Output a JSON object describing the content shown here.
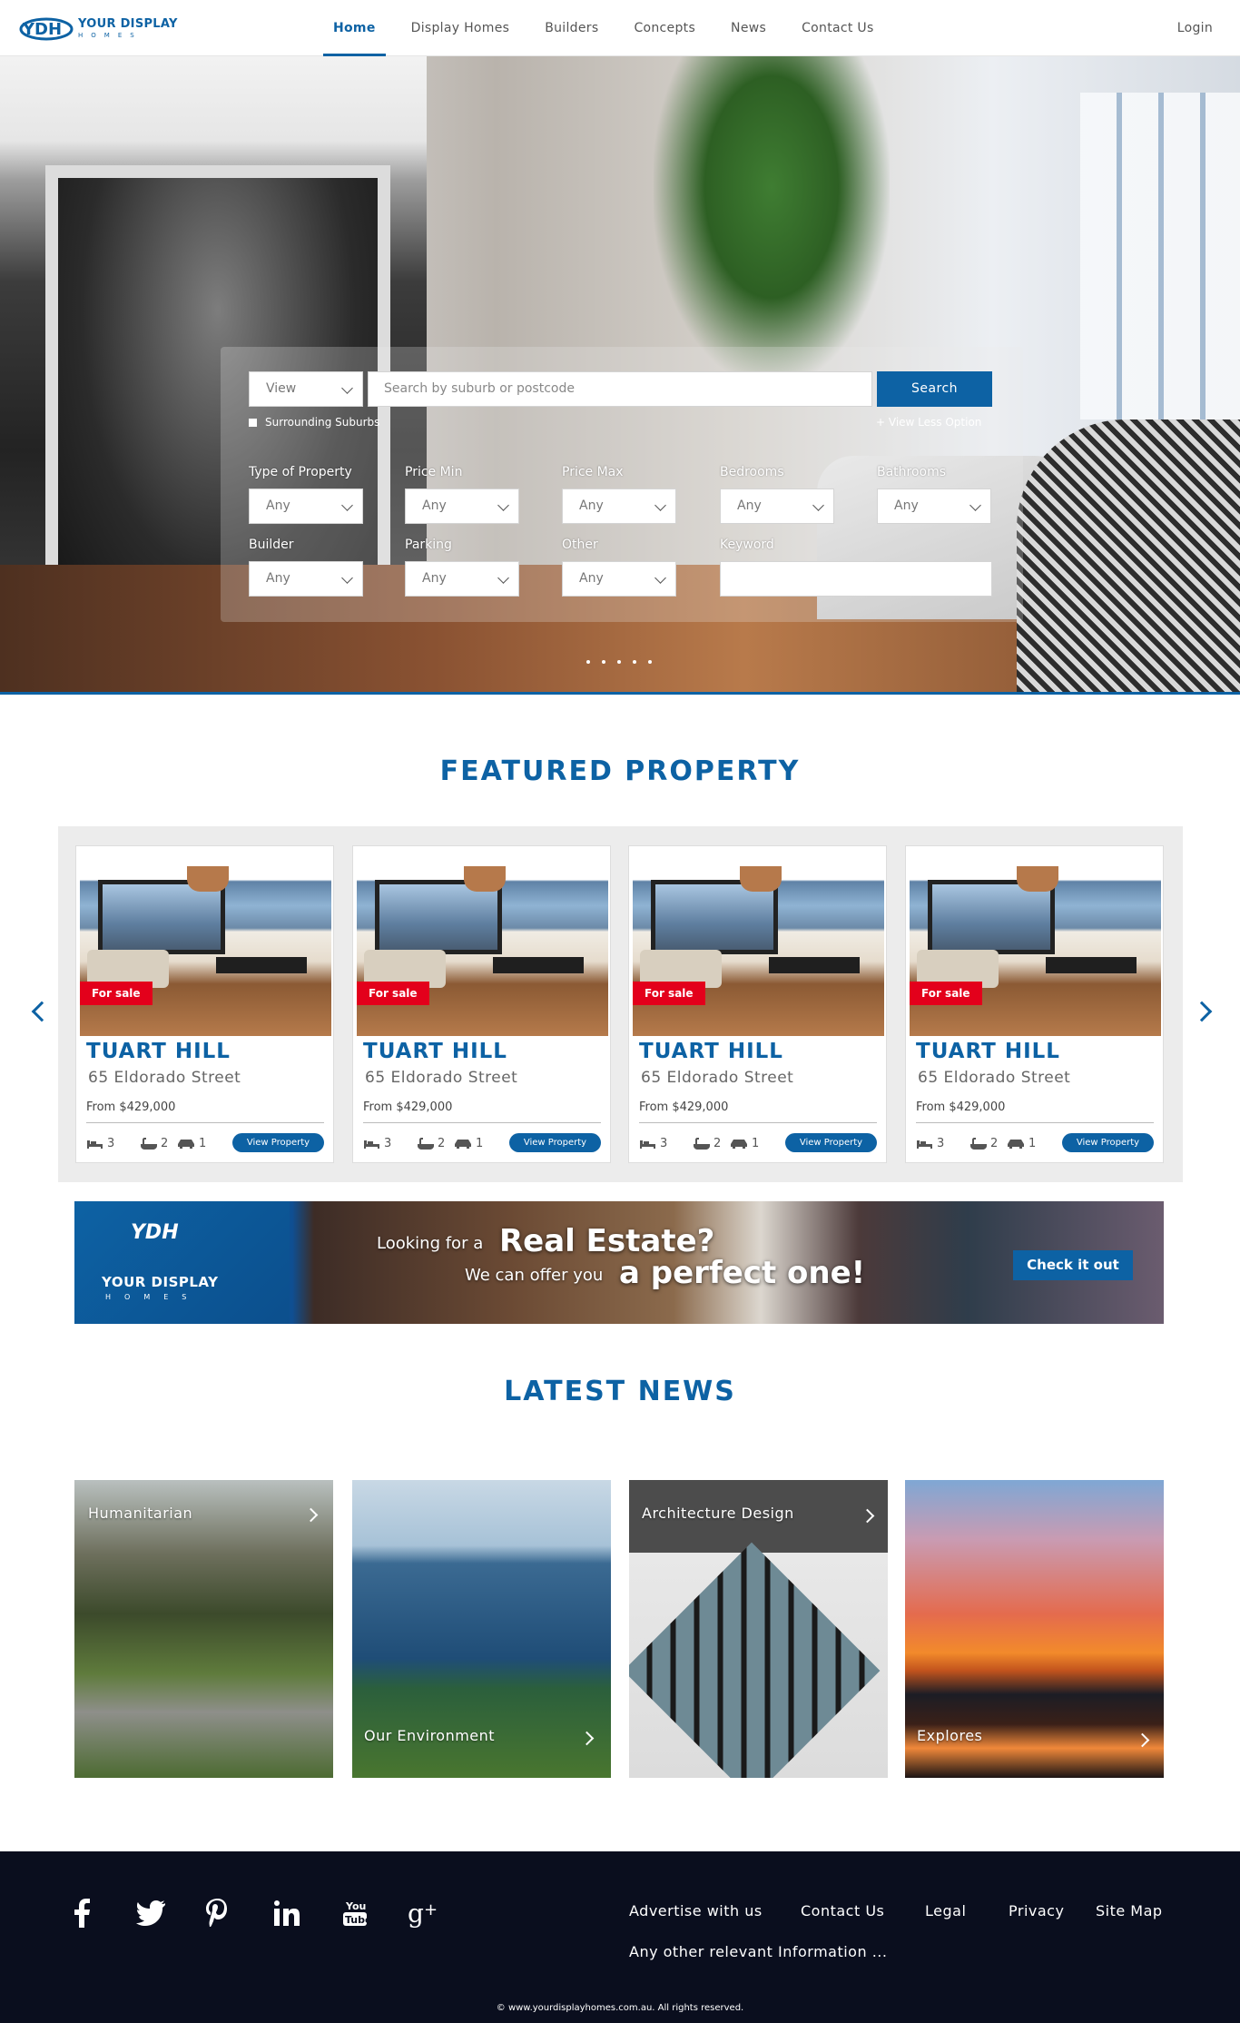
{
  "nav": {
    "logo_short": "YDH",
    "logo_line1": "YOUR DISPLAY",
    "logo_line2": "HOMES",
    "links": [
      "Home",
      "Display Homes",
      "Builders",
      "Concepts",
      "News",
      "Contact Us"
    ],
    "active": "Home",
    "login": "Login"
  },
  "hero": {
    "view_select": "View",
    "search_placeholder": "Search by suburb or postcode",
    "search_button": "Search",
    "surrounding": "Surrounding Suburbs",
    "less_option": "+ View Less Option",
    "filters": {
      "type": {
        "label": "Type of Property",
        "value": "Any"
      },
      "price_min": {
        "label": "Price Min",
        "value": "Any"
      },
      "price_max": {
        "label": "Price Max",
        "value": "Any"
      },
      "bedrooms": {
        "label": "Bedrooms",
        "value": "Any"
      },
      "bathrooms": {
        "label": "Bathrooms",
        "value": "Any"
      },
      "builder": {
        "label": "Builder",
        "value": "Any"
      },
      "parking": {
        "label": "Parking",
        "value": "Any"
      },
      "other": {
        "label": "Other",
        "value": "Any"
      },
      "keyword": {
        "label": "Keyword",
        "value": ""
      }
    },
    "slide_count": 5
  },
  "featured": {
    "title": "FEATURED PROPERTY",
    "cards": [
      {
        "badge": "For sale",
        "title": "TUART HILL",
        "address": "65 Eldorado Street",
        "price": "From $429,000",
        "beds": "3",
        "baths": "2",
        "cars": "1",
        "button": "View Property"
      },
      {
        "badge": "For sale",
        "title": "TUART HILL",
        "address": "65 Eldorado Street",
        "price": "From $429,000",
        "beds": "3",
        "baths": "2",
        "cars": "1",
        "button": "View Property"
      },
      {
        "badge": "For sale",
        "title": "TUART HILL",
        "address": "65 Eldorado Street",
        "price": "From $429,000",
        "beds": "3",
        "baths": "2",
        "cars": "1",
        "button": "View Property"
      },
      {
        "badge": "For sale",
        "title": "TUART HILL",
        "address": "65 Eldorado Street",
        "price": "From $429,000",
        "beds": "3",
        "baths": "2",
        "cars": "1",
        "button": "View Property"
      }
    ]
  },
  "banner": {
    "logo_short": "YDH",
    "logo_line1": "YOUR DISPLAY",
    "logo_line2": "HOMES",
    "line1a": "Looking for a",
    "line1b": "Real Estate?",
    "line2a": "We can offer you",
    "line2b": "a perfect one!",
    "button": "Check it out"
  },
  "news": {
    "title": "LATEST NEWS",
    "items": [
      "Humanitarian",
      "Our Environment",
      "Architecture Design",
      "Explores"
    ]
  },
  "footer": {
    "social": [
      "facebook-icon",
      "twitter-icon",
      "pinterest-icon",
      "linkedin-icon",
      "youtube-icon",
      "google-plus-icon"
    ],
    "links": [
      "Advertise with us",
      "Contact Us",
      "Legal",
      "Privacy",
      "Site Map"
    ],
    "info": "Any other relevant Information ...",
    "copyright": "© www.yourdisplayhomes.com.au. All rights reserved."
  },
  "colors": {
    "brand": "#0d62a4",
    "badge": "#e3001b",
    "footer": "#0a0e1e"
  }
}
